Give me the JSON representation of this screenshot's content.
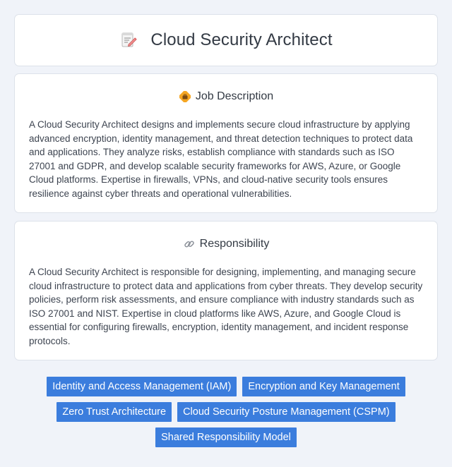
{
  "header": {
    "title": "Cloud Security Architect",
    "icon": "memo-icon"
  },
  "job_description": {
    "heading": "Job Description",
    "icon": "briefcase-icon",
    "text": "A Cloud Security Architect designs and implements secure cloud infrastructure by applying advanced encryption, identity management, and threat detection techniques to protect data and applications. They analyze risks, establish compliance with standards such as ISO 27001 and GDPR, and develop scalable security frameworks for AWS, Azure, or Google Cloud platforms. Expertise in firewalls, VPNs, and cloud-native security tools ensures resilience against cyber threats and operational vulnerabilities."
  },
  "responsibility": {
    "heading": "Responsibility",
    "icon": "link-icon",
    "text": "A Cloud Security Architect is responsible for designing, implementing, and managing secure cloud infrastructure to protect data and applications from cyber threats. They develop security policies, perform risk assessments, and ensure compliance with industry standards such as ISO 27001 and NIST. Expertise in cloud platforms like AWS, Azure, and Google Cloud is essential for configuring firewalls, encryption, identity management, and incident response protocols."
  },
  "tags": [
    "Identity and Access Management (IAM)",
    "Encryption and Key Management",
    "Zero Trust Architecture",
    "Cloud Security Posture Management (CSPM)",
    "Shared Responsibility Model"
  ],
  "colors": {
    "background": "#f0f3f9",
    "card": "#ffffff",
    "tag": "#3b7ddd",
    "text": "#333a44"
  }
}
